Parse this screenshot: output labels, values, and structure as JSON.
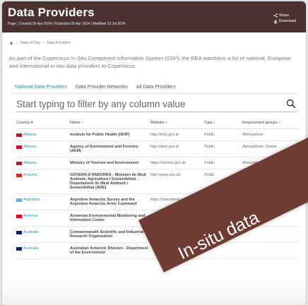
{
  "header": {
    "title": "Data Providers",
    "meta": "Page | Created 05 Apr 2024 | Published 05 Apr 2024 | Modified 23 Jul 2024",
    "share_label": "Share",
    "download_label": "Download"
  },
  "breadcrumb": [
    "State of Play",
    "Data Providers"
  ],
  "intro": "As part of the Copernicus In Situ Component Information System (CIS²), the EEA maintains a list of national, European and international in-situ data providers to Copernicus.",
  "tabs": [
    "National Data Providers",
    "Data Provider Networks",
    "All Data Providers"
  ],
  "filter": {
    "placeholder": "Start typing to filter by any column value"
  },
  "table": {
    "headers": [
      "Country",
      "Name",
      "Website",
      "Type",
      "Requirement groups"
    ],
    "rows": [
      {
        "country": "Albania",
        "name": "Institute for Public Health (ISHP)",
        "website": "http://ishp.gov.al",
        "type": "Public",
        "groups": "Atmosphere",
        "flag": "#c8102e"
      },
      {
        "country": "Albania",
        "name": "Agency of Environment and Forestry (AKM)",
        "website": "http://akm.gov.al",
        "type": "Public",
        "groups": "Atmosphere, Ocean",
        "flag": "#c8102e"
      },
      {
        "country": "Albania",
        "name": "Ministry of Tourism and Environment",
        "website": "https://turizmi.gov.al/",
        "type": "Public",
        "groups": "Atmosphere",
        "flag": "#c8102e"
      },
      {
        "country": "Andorra",
        "name": "GOVERN D'ANDORRA - Ministeri de Medi Ambient, Agricultura i Sostenibilitat - Departament de Medi Ambient i Sostenibilitat (ARE)",
        "website": "http://www.are.ad",
        "type": "Public",
        "groups": "Atmosphere",
        "flag": "#d52b1e"
      },
      {
        "country": "Argentina",
        "name": "Argentine Antarctic Survey and the Argentine Antarctic Army Command",
        "website": "https://cancilleria.gob.ar/es/iniciativas/dna",
        "type": "Research",
        "groups": "",
        "flag": "#74acdf"
      },
      {
        "country": "Armenia",
        "name": "Armenian Environmental Monitoring and Information Center",
        "website": "https://www.env.am",
        "type": "",
        "groups": "",
        "flag": "#d90012"
      },
      {
        "country": "Australia",
        "name": "Commonwealth Scientific and Industrial Research Organisation",
        "website": "",
        "type": "",
        "groups": "",
        "flag": "#012169"
      },
      {
        "country": "Australia",
        "name": "Australian Antarctic Division - Department of the Environment",
        "website": "",
        "type": "",
        "groups": "",
        "flag": "#012169"
      }
    ]
  },
  "banner": {
    "line1": "In-situ data",
    "line2": "providers"
  }
}
